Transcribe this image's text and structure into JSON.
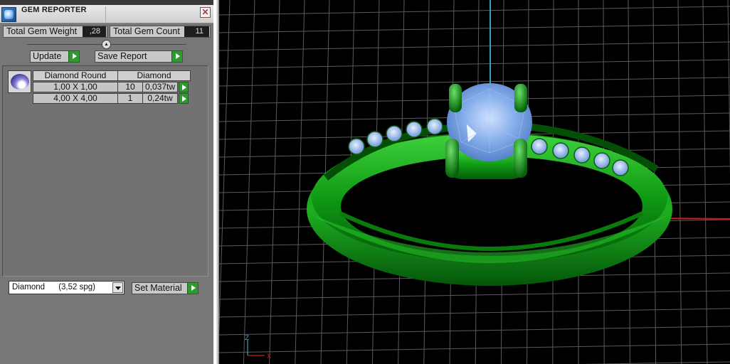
{
  "window": {
    "title": "GEM REPORTER",
    "close_glyph": "✕"
  },
  "summary": {
    "total_weight_label": "Total Gem Weight",
    "total_weight_value": ",28",
    "total_count_label": "Total Gem Count",
    "total_count_value": "11"
  },
  "toolbar": {
    "update_label": "Update",
    "save_report_label": "Save Report"
  },
  "gem_table": {
    "headers": [
      "Diamond Round",
      "Diamond"
    ],
    "rows": [
      {
        "size": "1,00 X 1,00",
        "count": "10",
        "weight": "0,037tw"
      },
      {
        "size": "4,00 X 4,00",
        "count": "1",
        "weight": "0,24tw"
      }
    ]
  },
  "material": {
    "selected": "Diamond      (3,52 spg)",
    "set_material_label": "Set Material"
  },
  "viewport": {
    "axis_labels": {
      "z": "Z",
      "x": "X"
    }
  },
  "colors": {
    "metal": "#0e8a12",
    "gem": "#7aa6e6",
    "grid": "#5a5a5a",
    "axis_blue": "#3aa0c0",
    "axis_red": "#c81e1e"
  },
  "icons": {
    "app": "gem-reporter-app-icon",
    "close": "close-icon",
    "arrow": "play-arrow-icon",
    "dropdown": "chevron-down-icon",
    "gem_thumbnail": "diamond-round-icon"
  }
}
